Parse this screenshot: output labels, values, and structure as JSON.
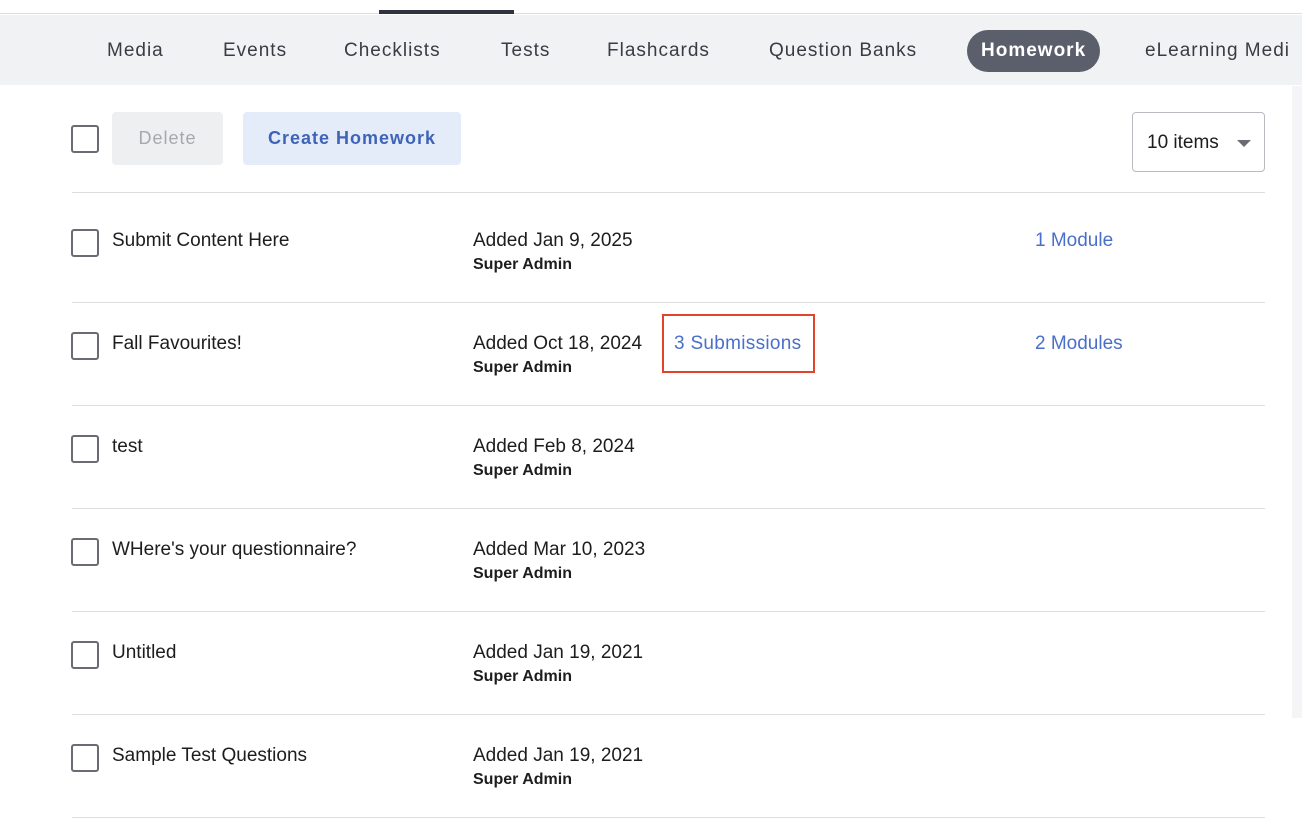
{
  "tabs": [
    {
      "label": "Media",
      "active": false
    },
    {
      "label": "Events",
      "active": false
    },
    {
      "label": "Checklists",
      "active": false
    },
    {
      "label": "Tests",
      "active": false
    },
    {
      "label": "Flashcards",
      "active": false
    },
    {
      "label": "Question Banks",
      "active": false
    },
    {
      "label": "Homework",
      "active": true
    },
    {
      "label": "eLearning Medi",
      "active": false
    }
  ],
  "toolbar": {
    "delete_label": "Delete",
    "create_label": "Create Homework",
    "items_per_page": "10 items"
  },
  "rows": [
    {
      "title": "Submit Content Here",
      "date": "Added Jan 9, 2025",
      "author": "Super Admin",
      "submissions": "",
      "modules": "1 Module"
    },
    {
      "title": "Fall Favourites!",
      "date": "Added Oct 18, 2024",
      "author": "Super Admin",
      "submissions": "3 Submissions",
      "modules": "2 Modules"
    },
    {
      "title": "test",
      "date": "Added Feb 8, 2024",
      "author": "Super Admin",
      "submissions": "",
      "modules": ""
    },
    {
      "title": "WHere's your questionnaire?",
      "date": "Added Mar 10, 2023",
      "author": "Super Admin",
      "submissions": "",
      "modules": ""
    },
    {
      "title": "Untitled",
      "date": "Added Jan 19, 2021",
      "author": "Super Admin",
      "submissions": "",
      "modules": ""
    },
    {
      "title": "Sample Test Questions",
      "date": "Added Jan 19, 2021",
      "author": "Super Admin",
      "submissions": "",
      "modules": ""
    }
  ],
  "colors": {
    "active_tab_bg": "#5b5e6b",
    "link": "#4a6fc9",
    "highlight_border": "#e0442b",
    "create_button_bg": "#e4ecfa"
  }
}
